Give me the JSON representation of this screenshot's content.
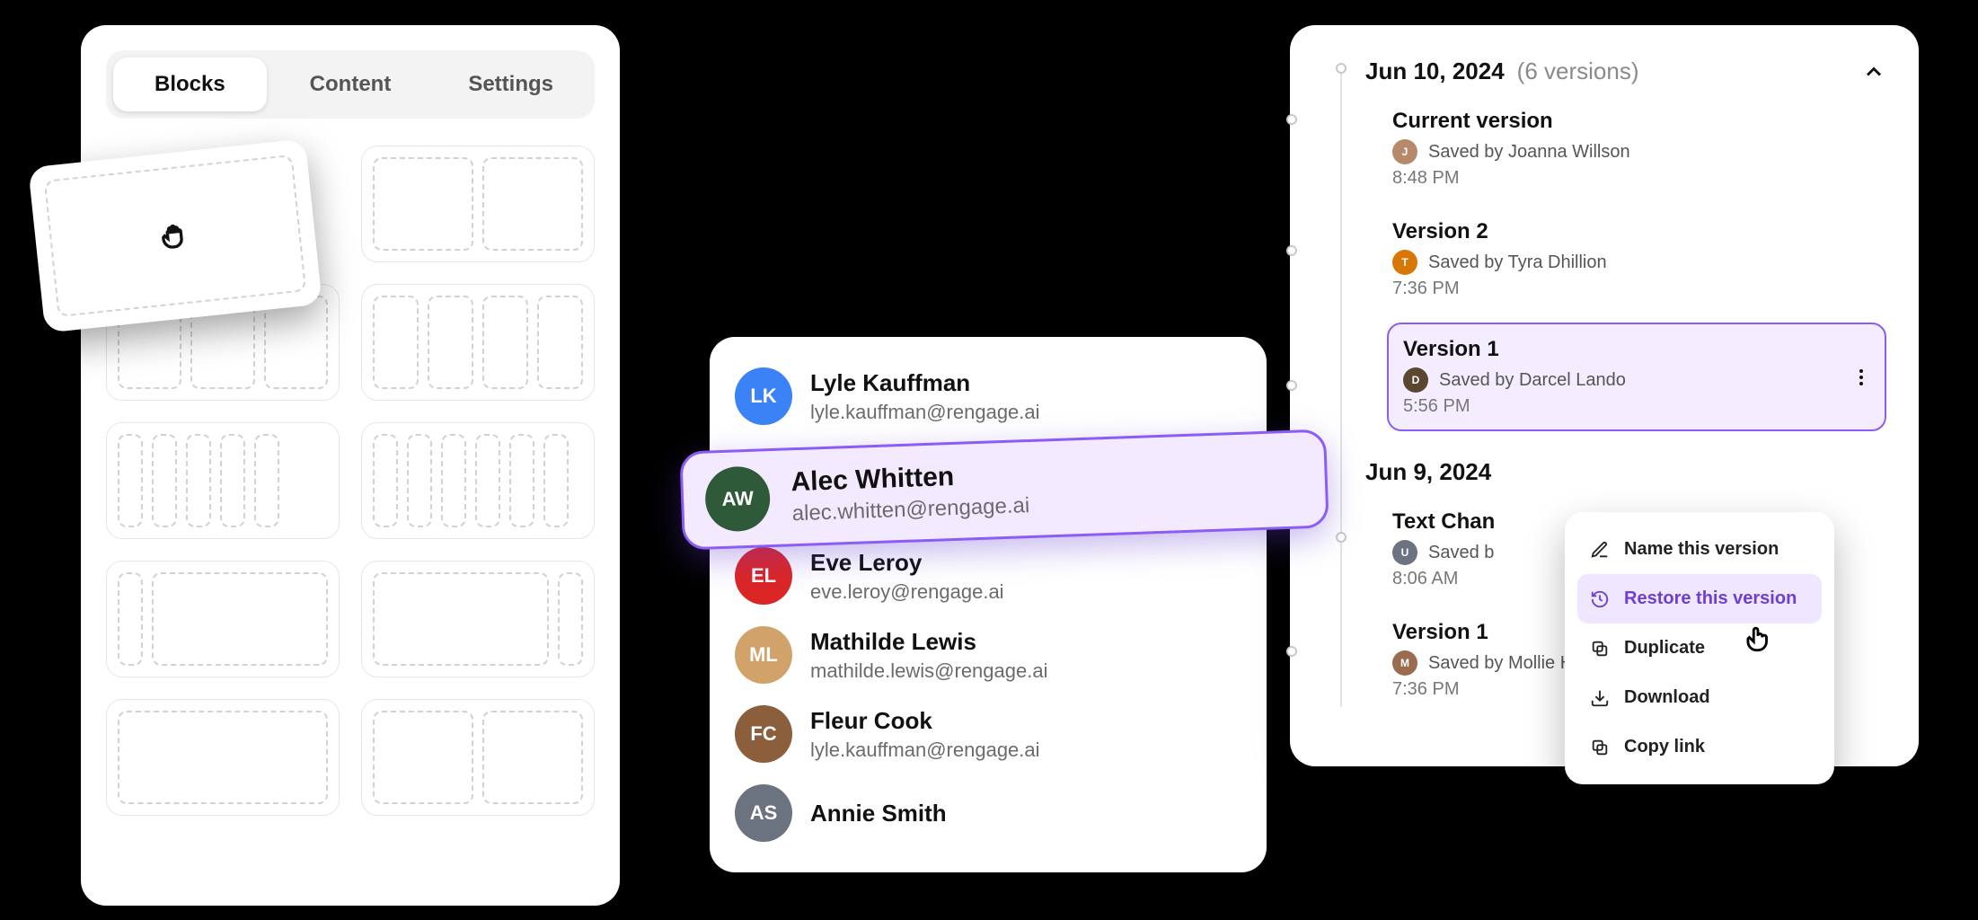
{
  "tabs": {
    "blocks": "Blocks",
    "content": "Content",
    "settings": "Settings"
  },
  "people": [
    {
      "name": "Lyle Kauffman",
      "email": "lyle.kauffman@rengage.ai",
      "color": "#3b82f6"
    },
    {
      "name": "Alec Whitten",
      "email": "alec.whitten@rengage.ai",
      "color": "#2f5a3a"
    },
    {
      "name": "Eve Leroy",
      "email": "eve.leroy@rengage.ai",
      "color": "#dc2626"
    },
    {
      "name": "Mathilde Lewis",
      "email": "mathilde.lewis@rengage.ai",
      "color": "#d1a36b"
    },
    {
      "name": "Fleur Cook",
      "email": "lyle.kauffman@rengage.ai",
      "color": "#8b5e3c"
    },
    {
      "name": "Annie Smith",
      "email": "",
      "color": "#6b7280"
    }
  ],
  "selectedPerson": {
    "name": "Alec Whitten",
    "email": "alec.whitten@rengage.ai",
    "color": "#2f5a3a"
  },
  "history": {
    "groups": [
      {
        "date": "Jun 10, 2024",
        "count_label": "(6 versions)",
        "versions": [
          {
            "title": "Current version",
            "saved_by": "Saved by Joanna Willson",
            "time": "8:48 PM",
            "color": "#b6896b"
          },
          {
            "title": "Version 2",
            "saved_by": "Saved by Tyra Dhillion",
            "time": "7:36 PM",
            "color": "#d97706"
          },
          {
            "title": "Version 1",
            "saved_by": "Saved by Darcel Lando",
            "time": "5:56 PM",
            "color": "#5b4630",
            "selected": true
          }
        ]
      },
      {
        "date": "Jun 9, 2024",
        "count_label": "",
        "versions": [
          {
            "title": "Text Chan",
            "saved_by": "Saved b",
            "time": "8:06 AM",
            "color": "#6b7280"
          },
          {
            "title": "Version 1",
            "saved_by": "Saved by Mollie Hall",
            "time": "7:36 PM",
            "color": "#9a6b4f"
          }
        ]
      }
    ]
  },
  "menu": {
    "name": "Name this version",
    "restore": "Restore this version",
    "duplicate": "Duplicate",
    "download": "Download",
    "copy": "Copy link"
  }
}
